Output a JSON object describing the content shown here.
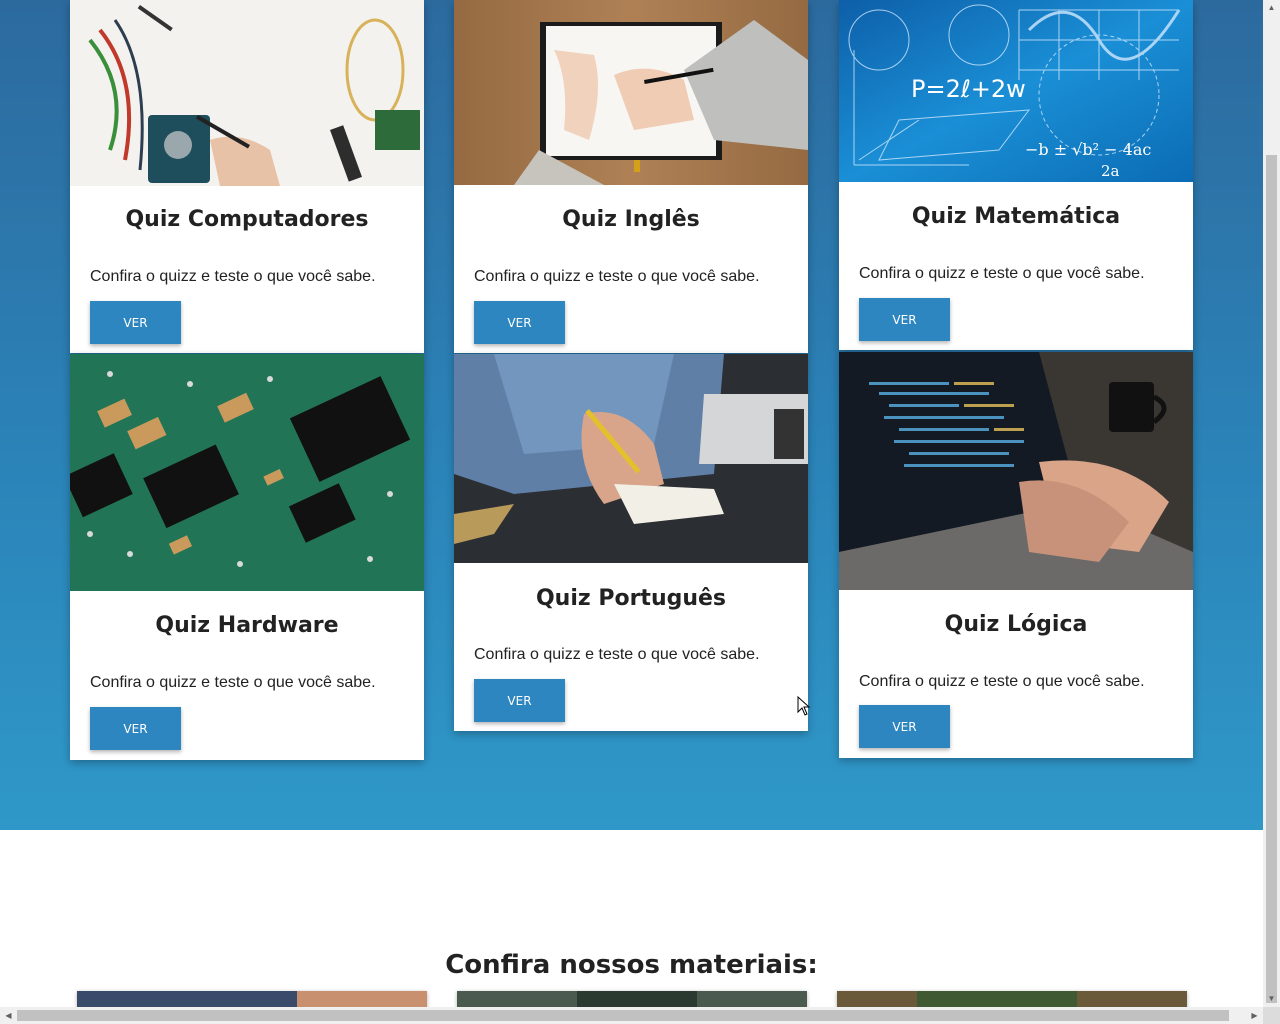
{
  "quiz_cards": [
    {
      "title": "Quiz Computadores",
      "text": "Confira o quizz e teste o que você sabe.",
      "button": "VER",
      "image_icon": "electronics-workbench-photo"
    },
    {
      "title": "Quiz Inglês",
      "text": "Confira o quizz e teste o que você sabe.",
      "button": "VER",
      "image_icon": "notebook-writing-photo"
    },
    {
      "title": "Quiz Matemática",
      "text": "Confira o quizz e teste o que você sabe.",
      "button": "VER",
      "image_icon": "math-formulas-photo"
    },
    {
      "title": "Quiz Hardware",
      "text": "Confira o quizz e teste o que você sabe.",
      "button": "VER",
      "image_icon": "circuit-board-photo"
    },
    {
      "title": "Quiz Português",
      "text": "Confira o quizz e teste o que você sabe.",
      "button": "VER",
      "image_icon": "writing-on-paper-photo"
    },
    {
      "title": "Quiz Lógica",
      "text": "Confira o quizz e teste o que você sabe.",
      "button": "VER",
      "image_icon": "laptop-coding-photo"
    }
  ],
  "materials": {
    "title": "Confira nossos materiais:"
  },
  "math_image_text": {
    "formula": "P=2ℓ+2w",
    "quadratic": "−b ± √b² − 4ac",
    "denominator": "2a"
  },
  "colors": {
    "section_gradient_top": "#2c6a9e",
    "section_gradient_bottom": "#2f98c9",
    "button": "#2e86c1"
  }
}
